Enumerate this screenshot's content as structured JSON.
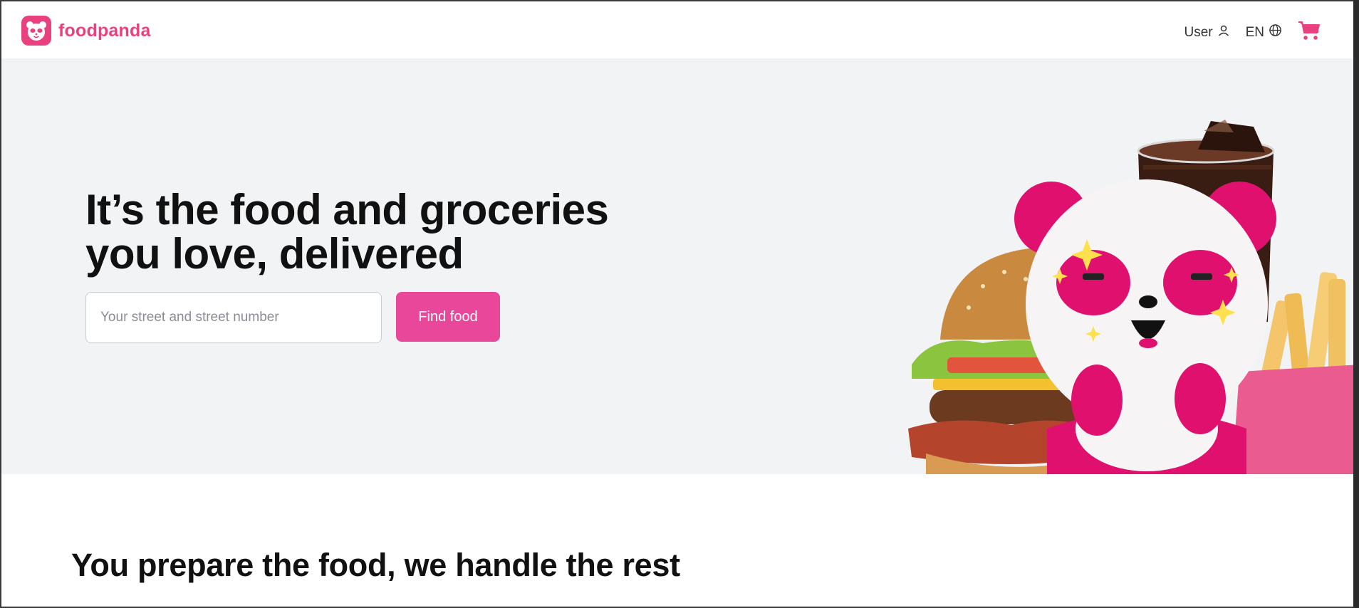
{
  "header": {
    "brand_name": "foodpanda",
    "user_label": "User",
    "language_label": "EN"
  },
  "hero": {
    "title_line1": "It’s the food and groceries",
    "title_line2": "you love, delivered",
    "address_placeholder": "Your street and street number",
    "find_button_label": "Find food"
  },
  "section": {
    "title": "You prepare the food, we handle the rest"
  },
  "colors": {
    "brand_pink": "#e9417f",
    "button_pink": "#e9479a",
    "hero_bg": "#f2f3f5"
  },
  "icons": {
    "logo": "panda-logo-icon",
    "user": "user-icon",
    "language": "globe-icon",
    "cart": "cart-icon"
  }
}
